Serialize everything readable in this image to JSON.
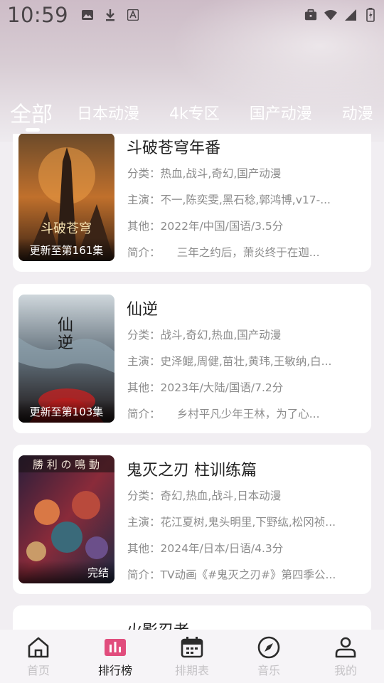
{
  "status_bar": {
    "time": "10:59",
    "left_icons": [
      "image-icon",
      "download-icon",
      "font-icon"
    ],
    "right_icons": [
      "briefcase-icon",
      "wifi-icon",
      "signal-icon",
      "battery-icon"
    ]
  },
  "tabs": [
    {
      "label": "全部",
      "active": true
    },
    {
      "label": "日本动漫"
    },
    {
      "label": "4k专区"
    },
    {
      "label": "国产动漫"
    },
    {
      "label": "动漫"
    }
  ],
  "items": [
    {
      "title": "斗破苍穹年番",
      "category": "分类：热血,战斗,奇幻,国产动漫",
      "cast": "主演：不一,陈奕雯,黑石稔,郭鸿博,v17-...",
      "other": "其他：2022年/中国/国语/3.5分",
      "intro": "简介：　　三年之约后，萧炎终于在迦...",
      "badge": "更新至第161集"
    },
    {
      "title": "仙逆",
      "category": "分类：战斗,奇幻,热血,国产动漫",
      "cast": "主演：史泽鲲,周健,苗壮,黄玮,王敏纳,白...",
      "other": "其他：2023年/大陆/国语/7.2分",
      "intro": "简介：　　乡村平凡少年王林，为了心...",
      "badge": "更新至第103集"
    },
    {
      "title": "鬼灭之刃 柱训练篇",
      "category": "分类：奇幻,热血,战斗,日本动漫",
      "cast": "主演：花江夏树,鬼头明里,下野纮,松冈祯...",
      "other": "其他：2024年/日本/日语/4.3分",
      "intro": "简介：TV动画《#鬼灭之刃#》第四季公...",
      "badge": "完结"
    },
    {
      "title": "火影忍者"
    }
  ],
  "nav": [
    {
      "label": "首页",
      "icon": "home-icon"
    },
    {
      "label": "排行榜",
      "icon": "chart-icon",
      "active": true
    },
    {
      "label": "排期表",
      "icon": "calendar-icon"
    },
    {
      "label": "音乐",
      "icon": "compass-icon"
    },
    {
      "label": "我的",
      "icon": "user-icon"
    }
  ],
  "colors": {
    "accent": "#e14d7d",
    "inactive": "#c5c3c6",
    "card_bg": "#ffffff"
  }
}
